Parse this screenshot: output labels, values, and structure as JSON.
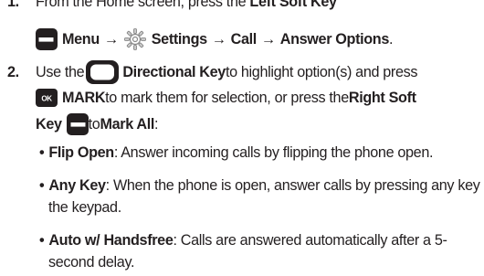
{
  "step1": {
    "number": "1.",
    "line1_pre": "From the Home screen, press the ",
    "line1_bold": "Left Soft Key",
    "menu": "Menu",
    "arrow": "→",
    "settings": "Settings",
    "call": "Call",
    "answer_options": "Answer Options",
    "end": "."
  },
  "step2": {
    "number": "2.",
    "use": "Use the ",
    "directional_key": "Directional Key",
    "line1_post": " to highlight option(s) and press",
    "ok_glyph": "OK",
    "mark": "MARK",
    "line2_mid": " to mark them for selection, or press the ",
    "right_soft": "Right Soft",
    "key": "Key",
    "to": " to ",
    "mark_all": "Mark All",
    "colon": ":"
  },
  "bullets": [
    {
      "title": "Flip Open",
      "text_l1": ": Answer incoming calls by flipping the phone open.",
      "text_l2": ""
    },
    {
      "title": "Any Key",
      "text_l1": ": When the phone is open, answer calls by pressing any key on",
      "text_l2": "the keypad."
    },
    {
      "title": "Auto w/ Handsfree",
      "text_l1": ": Calls are answered automatically after a 5-",
      "text_l2": "second delay."
    }
  ],
  "bullet_glyph": "•",
  "colors": {
    "text": "#231f20",
    "key_dark": "#231f20",
    "icon_gray": "#8a8a8a"
  },
  "icons": [
    "left-soft-key-icon",
    "settings-icon",
    "directional-key-icon",
    "ok-key-icon",
    "right-soft-key-icon"
  ]
}
